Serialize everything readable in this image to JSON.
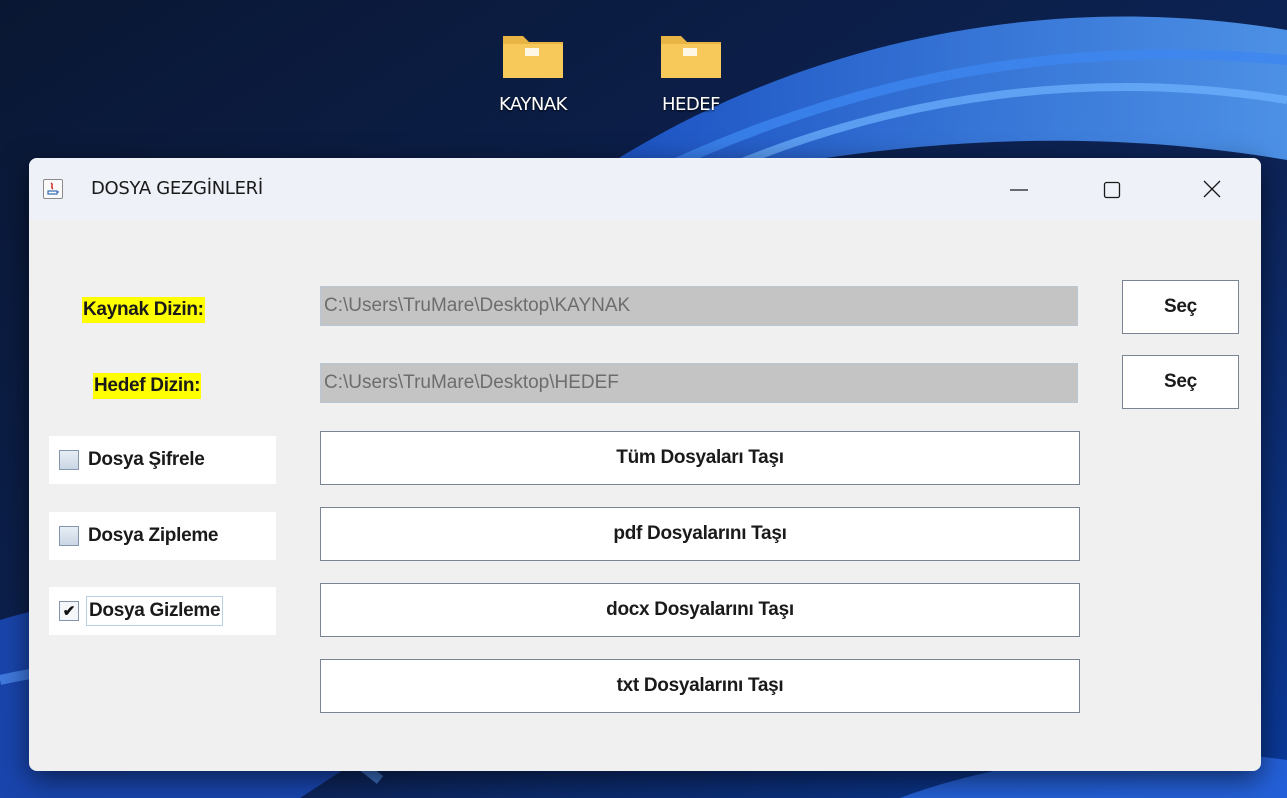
{
  "desktop": {
    "icons": [
      {
        "label": "KAYNAK",
        "icon": "folder-icon"
      },
      {
        "label": "HEDEF",
        "icon": "folder-icon"
      }
    ]
  },
  "window": {
    "title": "DOSYA GEZGİNLERİ",
    "app_icon": "java-icon",
    "controls": [
      "minimize-icon",
      "maximize-icon",
      "close-icon"
    ]
  },
  "form": {
    "source": {
      "label": "Kaynak Dizin:",
      "path": "C:\\Users\\TruMare\\Desktop\\KAYNAK",
      "button": "Seç"
    },
    "target": {
      "label": "Hedef Dizin:",
      "path": "C:\\Users\\TruMare\\Desktop\\HEDEF",
      "button": "Seç"
    },
    "options": [
      {
        "label": "Dosya Şifrele",
        "checked": false
      },
      {
        "label": "Dosya Zipleme",
        "checked": false
      },
      {
        "label": "Dosya Gizleme",
        "checked": true
      }
    ],
    "actions": [
      "Tüm Dosyaları Taşı",
      "pdf Dosyalarını Taşı",
      "docx Dosyalarını Taşı",
      "txt Dosyalarını Taşı"
    ]
  },
  "colors": {
    "label_highlight": "#ffff00",
    "path_field_bg": "#c4c4c4",
    "window_bg": "#f0f0f0"
  }
}
